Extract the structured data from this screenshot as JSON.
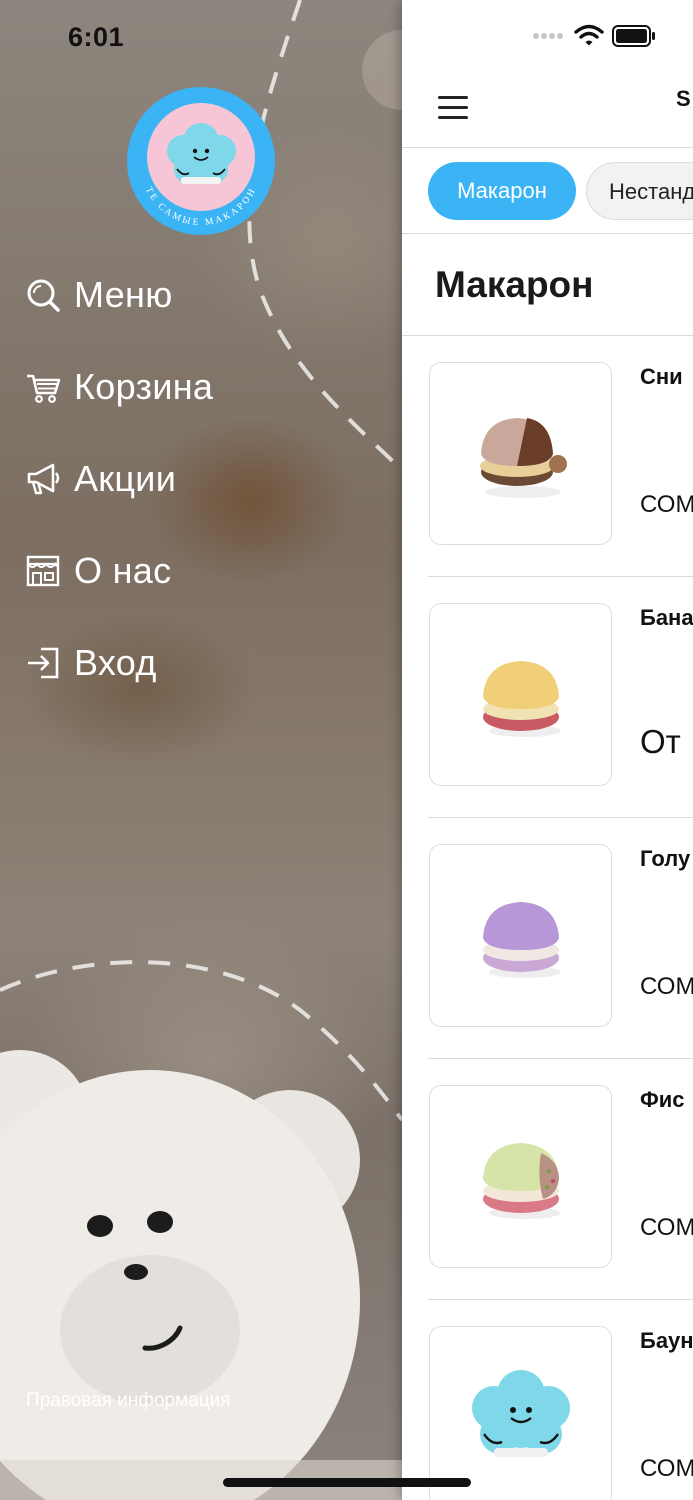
{
  "status_bar": {
    "time": "6:01"
  },
  "drawer": {
    "logo_text": "ТЕ САМЫЕ МАКАРОН",
    "menu": [
      {
        "icon": "search-icon",
        "label": "Меню"
      },
      {
        "icon": "cart-icon",
        "label": "Корзина"
      },
      {
        "icon": "megaphone-icon",
        "label": "Акции"
      },
      {
        "icon": "store-icon",
        "label": "О нас"
      },
      {
        "icon": "login-icon",
        "label": "Вход"
      }
    ],
    "legal": "Правовая информация"
  },
  "main": {
    "header_title": "S",
    "tabs": [
      {
        "label": "Макарон",
        "active": true
      },
      {
        "label": "Нестанд",
        "active": false
      }
    ],
    "section_title": "Макарон",
    "products": [
      {
        "name": "Сни",
        "meta": "СОМ"
      },
      {
        "name": "Бана",
        "price": "От"
      },
      {
        "name": "Голу",
        "meta": "СОМ"
      },
      {
        "name": "Фис",
        "meta": "СОМ"
      },
      {
        "name": "Баун",
        "meta": "СОМ"
      }
    ]
  },
  "colors": {
    "accent": "#3bb4f6",
    "logo_outer": "#3bb4f6",
    "logo_inner": "#f6c6d6",
    "cloud": "#7fd8ea"
  }
}
